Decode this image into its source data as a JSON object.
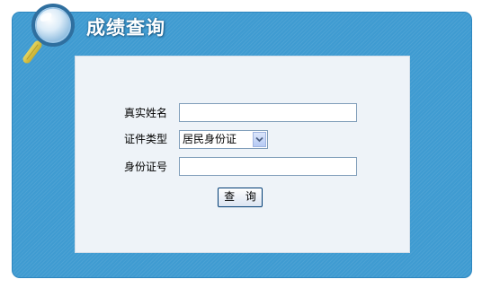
{
  "header": {
    "title": "成绩查询",
    "icon": "magnifier-icon"
  },
  "form": {
    "name_label": "真实姓名",
    "name_value": "",
    "id_type_label": "证件类型",
    "id_type_selected": "居民身份证",
    "id_number_label": "身份证号",
    "id_number_value": "",
    "submit_label": "查 询"
  },
  "colors": {
    "frame": "#3f9bd1",
    "panel": "#eef3f8",
    "input_border": "#7f9db9",
    "button_border": "#003c74"
  }
}
